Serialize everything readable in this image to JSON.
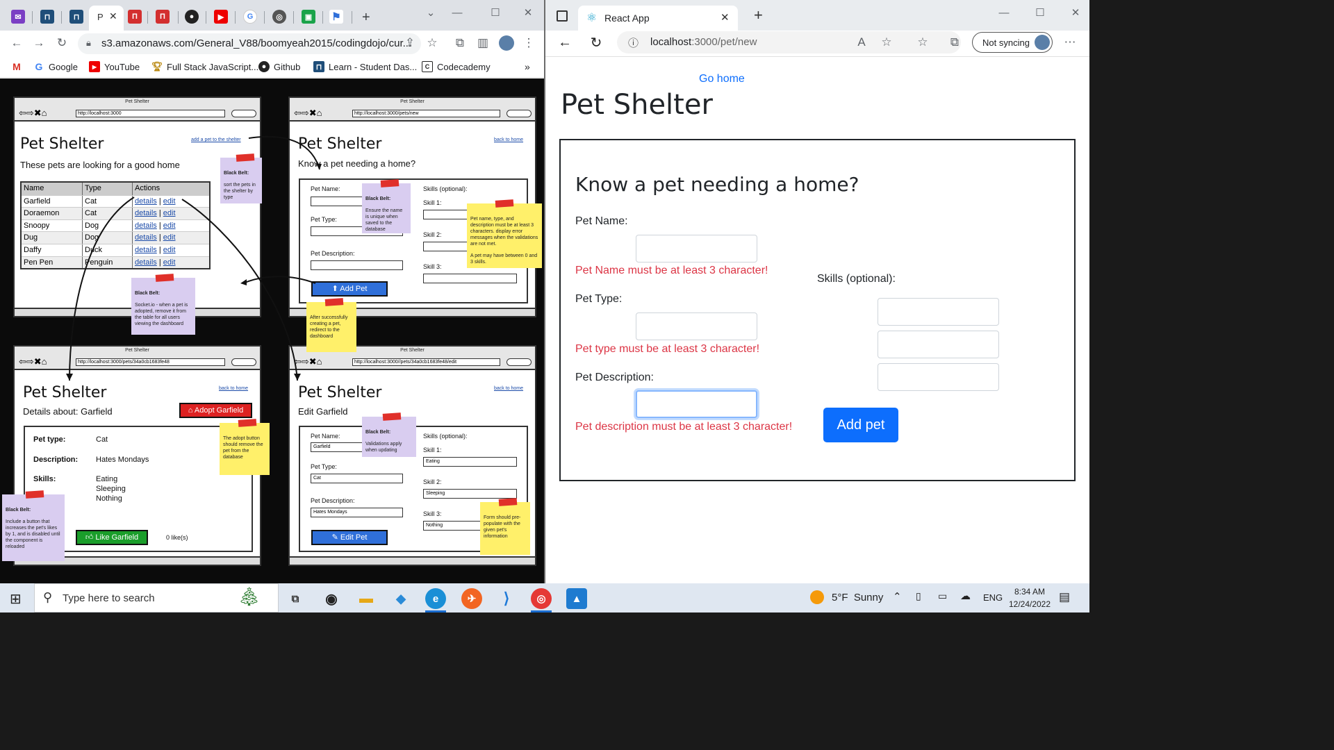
{
  "left_window": {
    "active_tab_label": "P",
    "url": "s3.amazonaws.com/General_V88/boomyeah2015/codingdojo/cur...",
    "bookmarks": [
      {
        "label": "",
        "icon": "gmail-icon"
      },
      {
        "label": "Google",
        "icon": "google-icon"
      },
      {
        "label": "YouTube",
        "icon": "youtube-icon"
      },
      {
        "label": "Full Stack JavaScript...",
        "icon": "trophy-icon"
      },
      {
        "label": "Github",
        "icon": "github-icon"
      },
      {
        "label": "Learn - Student Das...",
        "icon": "learn-icon"
      },
      {
        "label": "Codecademy",
        "icon": "codecademy-icon"
      }
    ],
    "more_bookmarks": "»"
  },
  "wireframe": {
    "window_caption": "Pet Shelter",
    "home": {
      "url": "http://localhost:3000",
      "title": "Pet Shelter",
      "link": "add a pet to the shelter",
      "subtitle": "These pets are looking for a good home",
      "columns": [
        "Name",
        "Type",
        "Actions"
      ],
      "rows": [
        [
          "Garfield",
          "Cat"
        ],
        [
          "Doraemon",
          "Cat"
        ],
        [
          "Snoopy",
          "Dog"
        ],
        [
          "Dug",
          "Dog"
        ],
        [
          "Daffy",
          "Duck"
        ],
        [
          "Pen Pen",
          "Penguin"
        ]
      ],
      "details": "details",
      "sep": "|",
      "edit": "edit"
    },
    "new": {
      "url": "http://localhost:3000/pets/new",
      "title": "Pet Shelter",
      "link": "back to home",
      "subtitle": "Know a pet needing a home?",
      "name_label": "Pet Name:",
      "type_label": "Pet Type:",
      "desc_label": "Pet Description:",
      "skills_label": "Skills (optional):",
      "skill1": "Skill 1:",
      "skill2": "Skill 2:",
      "skill3": "Skill 3:",
      "button": "Add Pet"
    },
    "details": {
      "url": "http://localhost:3000/pets/34a0cb1683fe48",
      "title": "Pet Shelter",
      "link": "back to home",
      "subtitle": "Details about: Garfield",
      "adopt": "Adopt Garfield",
      "type_label": "Pet type:",
      "type_val": "Cat",
      "desc_label": "Description:",
      "desc_val": "Hates Mondays",
      "skills_label": "Skills:",
      "skills": [
        "Eating",
        "Sleeping",
        "Nothing"
      ],
      "like": "Like Garfield",
      "likes": "0 like(s)"
    },
    "edit": {
      "url": "http://localhost:3000//pets/34a0cb1683fe48/edit",
      "title": "Pet Shelter",
      "link": "back to home",
      "subtitle": "Edit Garfield",
      "name_label": "Pet Name:",
      "name_val": "Garfield",
      "type_label": "Pet Type:",
      "type_val": "Cat",
      "desc_label": "Pet Description:",
      "desc_val": "Hates Mondays",
      "skills_label": "Skills (optional):",
      "skill1": "Skill 1:",
      "skill1_val": "Eating",
      "skill2": "Skill 2:",
      "skill2_val": "Sleeping",
      "skill3": "Skill 3:",
      "skill3_val": "Nothing",
      "button": "Edit Pet"
    },
    "notes": {
      "sort_title": "Black Belt:",
      "sort": "sort the pets in the shelter by type",
      "unique_title": "Black Belt:",
      "unique": "Ensure the name is unique when saved to the database",
      "validation": "Pet name, type, and description must be at least 3 characters. display error messages when the validations are not met.",
      "validation2": "A pet may have between 0 and 3 skills.",
      "socket_title": "Black Belt:",
      "socket": "Socket.io - when a pet is adopted, remove it from the table for all users viewing the dashboard",
      "redirect": "After successfully creating a pet, redirect to the dashboard",
      "adopt": "The adopt button should remove the pet from the database",
      "update_title": "Black Belt:",
      "update": "Validations apply when updating",
      "prepopulate": "Form should pre-populate with the given pet's information",
      "likes_title": "Black Belt:",
      "likes": "Include a button that increases the pet's likes by 1, and is disabled until the component is reloaded"
    }
  },
  "right_window": {
    "tab_title": "React App",
    "url_host": "localhost",
    "url_rest": ":3000/pet/new",
    "sync": "Not syncing",
    "go_home": "Go home",
    "title": "Pet Shelter",
    "form_title": "Know a pet needing a home?",
    "name_label": "Pet Name:",
    "name_error": "Pet Name must be at least 3 character!",
    "type_label": "Pet Type:",
    "type_error": "Pet type must be at least 3 character!",
    "desc_label": "Pet Description:",
    "desc_error": "Pet description must be at least 3 character!",
    "skills_label": "Skills (optional):",
    "button": "Add pet"
  },
  "taskbar": {
    "search": "Type here to search",
    "weather": "5°F  Sunny",
    "lang": "ENG",
    "time": "8:34 AM",
    "date": "12/24/2022"
  },
  "colors": {
    "error": "#dc3545",
    "primary": "#0d6efd",
    "link": "#0d6efd"
  }
}
